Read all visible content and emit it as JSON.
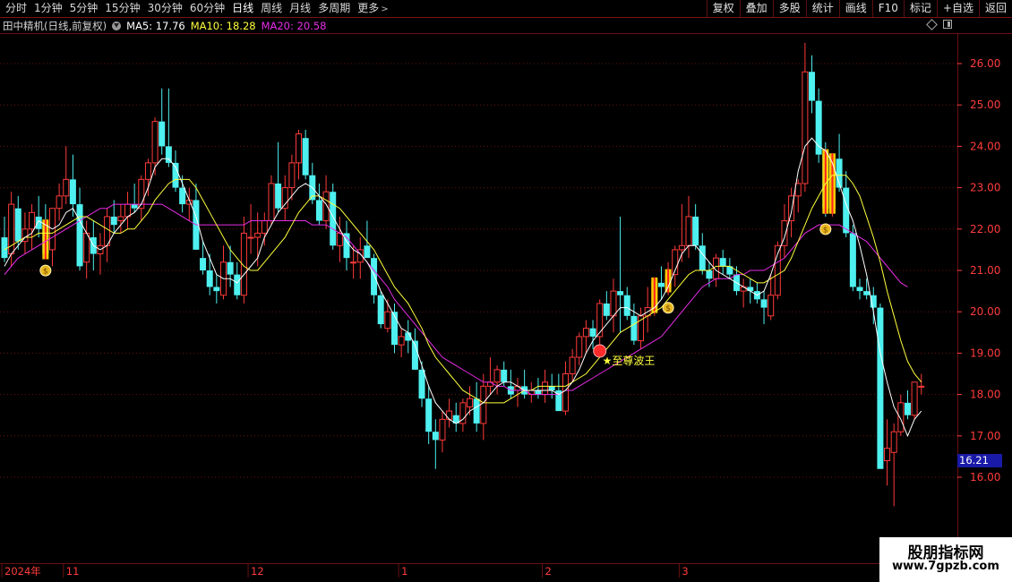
{
  "toolbar": {
    "tabs": [
      {
        "label": "分时",
        "active": false
      },
      {
        "label": "1分钟",
        "active": false
      },
      {
        "label": "5分钟",
        "active": false
      },
      {
        "label": "15分钟",
        "active": false
      },
      {
        "label": "30分钟",
        "active": false
      },
      {
        "label": "60分钟",
        "active": false
      },
      {
        "label": "日线",
        "active": true
      },
      {
        "label": "周线",
        "active": false
      },
      {
        "label": "月线",
        "active": false
      },
      {
        "label": "多周期",
        "active": false
      },
      {
        "label": "更多",
        "active": false
      }
    ],
    "tools": [
      "复权",
      "叠加",
      "多股",
      "统计",
      "画线",
      "F10",
      "标记",
      "+自选",
      "返回"
    ]
  },
  "info": {
    "stock_name": "田中精机(日线,前复权)",
    "ma5": "MA5: 17.76",
    "ma10": "MA10: 18.28",
    "ma20": "MA20: 20.58"
  },
  "colors": {
    "up": "#ff3a3a",
    "down": "#4ef0f0",
    "ma5": "#ffffff",
    "ma10": "#ffff3c",
    "ma20": "#e62de6",
    "grid": "#6a1010",
    "axis_text": "#ff3c3c",
    "signal": "#ffd700"
  },
  "price_axis": {
    "labels": [
      "26.00",
      "25.00",
      "24.00",
      "23.00",
      "22.00",
      "21.00",
      "20.00",
      "19.00",
      "18.00",
      "17.00",
      "16.00"
    ],
    "current": "16.21"
  },
  "date_axis": {
    "labels": [
      "2024年",
      "11",
      "12",
      "1",
      "2",
      "3"
    ]
  },
  "annotations": {
    "signal_text": "★至尊波王"
  },
  "watermark": {
    "line1": "股朋指标网",
    "line2": "www.7gpzb.com"
  },
  "chart_data": {
    "type": "candlestick",
    "ylim": [
      15.2,
      26.9
    ],
    "ohlc": [
      [
        21.8,
        22.3,
        21.2,
        21.3
      ],
      [
        21.4,
        22.9,
        21.1,
        22.6
      ],
      [
        22.5,
        22.8,
        21.5,
        21.7
      ],
      [
        21.7,
        22.4,
        21.4,
        22.0
      ],
      [
        22.0,
        22.6,
        21.5,
        22.4
      ],
      [
        22.3,
        22.8,
        21.8,
        22.0
      ],
      [
        22.1,
        22.6,
        21.3,
        21.4
      ],
      [
        21.5,
        22.5,
        21.1,
        22.5
      ],
      [
        22.5,
        23.1,
        22.2,
        22.8
      ],
      [
        22.8,
        24.0,
        22.6,
        23.2
      ],
      [
        23.2,
        23.8,
        22.3,
        22.6
      ],
      [
        22.6,
        23.0,
        21.0,
        21.1
      ],
      [
        21.2,
        22.2,
        20.8,
        21.9
      ],
      [
        21.8,
        22.2,
        21.0,
        21.4
      ],
      [
        21.4,
        21.9,
        20.9,
        21.6
      ],
      [
        21.6,
        22.5,
        21.2,
        22.3
      ],
      [
        22.3,
        22.7,
        21.9,
        22.1
      ],
      [
        22.2,
        22.6,
        21.9,
        22.3
      ],
      [
        22.3,
        22.9,
        22.0,
        22.6
      ],
      [
        22.6,
        23.1,
        22.4,
        22.5
      ],
      [
        22.5,
        23.3,
        22.2,
        23.2
      ],
      [
        23.2,
        23.7,
        22.8,
        23.6
      ],
      [
        23.6,
        24.7,
        23.3,
        24.6
      ],
      [
        24.6,
        25.4,
        23.8,
        24.0
      ],
      [
        24.0,
        25.4,
        23.5,
        23.6
      ],
      [
        23.6,
        23.9,
        22.9,
        23.0
      ],
      [
        23.0,
        23.3,
        22.4,
        22.6
      ],
      [
        22.6,
        23.0,
        22.2,
        22.7
      ],
      [
        22.7,
        23.1,
        21.9,
        21.5
      ],
      [
        21.3,
        21.7,
        20.9,
        21.0
      ],
      [
        21.0,
        21.4,
        20.4,
        20.6
      ],
      [
        20.6,
        20.9,
        20.2,
        20.5
      ],
      [
        20.4,
        21.6,
        20.3,
        21.2
      ],
      [
        21.2,
        21.6,
        20.6,
        20.9
      ],
      [
        20.9,
        21.2,
        20.3,
        20.4
      ],
      [
        20.4,
        22.3,
        20.2,
        21.9
      ],
      [
        21.8,
        22.6,
        21.4,
        21.8
      ],
      [
        21.8,
        22.4,
        21.1,
        21.9
      ],
      [
        21.9,
        22.4,
        21.6,
        22.2
      ],
      [
        22.2,
        23.3,
        22.1,
        23.1
      ],
      [
        23.1,
        24.1,
        22.4,
        22.5
      ],
      [
        22.5,
        23.3,
        22.2,
        23.0
      ],
      [
        23.0,
        23.8,
        22.7,
        23.6
      ],
      [
        23.6,
        24.4,
        23.2,
        24.3
      ],
      [
        24.2,
        24.4,
        23.2,
        23.3
      ],
      [
        23.3,
        23.6,
        22.6,
        22.7
      ],
      [
        22.7,
        23.1,
        22.1,
        22.2
      ],
      [
        22.2,
        23.3,
        22.0,
        22.9
      ],
      [
        22.9,
        23.1,
        21.5,
        21.6
      ],
      [
        21.6,
        22.3,
        21.2,
        21.9
      ],
      [
        21.9,
        22.2,
        21.0,
        21.3
      ],
      [
        21.2,
        21.6,
        20.8,
        21.2
      ],
      [
        21.2,
        21.8,
        20.8,
        21.5
      ],
      [
        21.6,
        22.2,
        21.5,
        21.3
      ],
      [
        21.3,
        21.4,
        20.2,
        20.4
      ],
      [
        20.4,
        20.5,
        19.6,
        19.7
      ],
      [
        19.6,
        20.3,
        19.5,
        20.0
      ],
      [
        20.0,
        20.2,
        19.0,
        19.2
      ],
      [
        19.2,
        19.6,
        18.9,
        19.4
      ],
      [
        19.5,
        19.8,
        19.0,
        19.3
      ],
      [
        19.3,
        19.6,
        18.6,
        18.6
      ],
      [
        18.6,
        18.8,
        17.7,
        17.9
      ],
      [
        17.9,
        18.2,
        16.8,
        17.1
      ],
      [
        17.1,
        17.4,
        16.2,
        16.9
      ],
      [
        16.9,
        17.6,
        16.6,
        17.4
      ],
      [
        17.4,
        17.9,
        17.2,
        17.6
      ],
      [
        17.5,
        17.8,
        17.1,
        17.3
      ],
      [
        17.3,
        17.9,
        17.1,
        17.8
      ],
      [
        17.7,
        18.2,
        17.5,
        17.9
      ],
      [
        17.9,
        18.3,
        17.1,
        17.3
      ],
      [
        17.3,
        18.5,
        16.9,
        18.2
      ],
      [
        18.2,
        18.9,
        18.0,
        18.3
      ],
      [
        18.3,
        18.7,
        18.0,
        18.6
      ],
      [
        18.6,
        18.8,
        18.2,
        18.3
      ],
      [
        18.2,
        18.6,
        17.9,
        18.0
      ],
      [
        18.1,
        18.4,
        17.7,
        18.2
      ],
      [
        18.2,
        18.6,
        17.9,
        18.0
      ],
      [
        18.0,
        18.3,
        17.8,
        18.1
      ],
      [
        18.1,
        18.4,
        17.9,
        18.0
      ],
      [
        18.0,
        18.6,
        17.8,
        18.3
      ],
      [
        18.2,
        18.5,
        17.9,
        18.1
      ],
      [
        18.1,
        18.5,
        17.6,
        17.6
      ],
      [
        17.6,
        18.8,
        17.5,
        18.5
      ],
      [
        18.5,
        19.1,
        18.3,
        18.9
      ],
      [
        18.9,
        19.5,
        18.7,
        19.4
      ],
      [
        19.4,
        19.8,
        19.0,
        19.6
      ],
      [
        19.6,
        19.8,
        19.1,
        19.4
      ],
      [
        19.4,
        20.3,
        19.2,
        20.2
      ],
      [
        20.2,
        20.5,
        19.8,
        19.9
      ],
      [
        19.9,
        20.8,
        19.5,
        20.5
      ],
      [
        20.5,
        22.3,
        19.5,
        20.4
      ],
      [
        20.4,
        20.6,
        19.8,
        19.9
      ],
      [
        19.9,
        20.2,
        19.2,
        19.3
      ],
      [
        19.3,
        20.1,
        19.1,
        19.9
      ],
      [
        19.9,
        20.6,
        19.5,
        20.1
      ],
      [
        20.1,
        20.8,
        19.9,
        20.7
      ],
      [
        20.7,
        21.1,
        20.3,
        20.6
      ],
      [
        20.6,
        21.2,
        20.4,
        20.9
      ],
      [
        20.9,
        21.6,
        20.6,
        21.5
      ],
      [
        21.5,
        22.6,
        21.2,
        21.6
      ],
      [
        21.6,
        22.8,
        21.3,
        22.3
      ],
      [
        22.3,
        22.6,
        21.5,
        21.6
      ],
      [
        21.6,
        21.9,
        20.9,
        21.0
      ],
      [
        21.0,
        21.2,
        20.6,
        20.8
      ],
      [
        20.8,
        21.4,
        20.6,
        21.3
      ],
      [
        21.3,
        21.5,
        20.9,
        21.1
      ],
      [
        21.1,
        21.3,
        20.8,
        20.9
      ],
      [
        20.9,
        21.1,
        20.4,
        20.5
      ],
      [
        20.5,
        20.8,
        20.1,
        20.6
      ],
      [
        20.6,
        20.8,
        20.2,
        20.5
      ],
      [
        20.5,
        20.7,
        20.2,
        20.3
      ],
      [
        20.3,
        20.5,
        19.7,
        20.1
      ],
      [
        19.9,
        20.9,
        19.8,
        20.4
      ],
      [
        20.4,
        21.7,
        20.3,
        21.6
      ],
      [
        21.6,
        22.6,
        21.3,
        22.2
      ],
      [
        22.2,
        23.0,
        21.8,
        22.8
      ],
      [
        22.8,
        23.2,
        22.4,
        23.1
      ],
      [
        23.1,
        26.5,
        22.9,
        25.8
      ],
      [
        25.8,
        26.2,
        24.8,
        25.1
      ],
      [
        25.1,
        25.4,
        23.6,
        23.8
      ],
      [
        23.8,
        24.1,
        22.3,
        22.5
      ],
      [
        22.5,
        23.8,
        22.3,
        23.7
      ],
      [
        23.7,
        24.3,
        22.9,
        23.0
      ],
      [
        23.0,
        23.4,
        21.8,
        21.9
      ],
      [
        21.9,
        22.1,
        20.5,
        20.6
      ],
      [
        20.6,
        20.8,
        20.3,
        20.5
      ],
      [
        20.5,
        20.8,
        20.3,
        20.4
      ],
      [
        20.4,
        20.6,
        19.7,
        20.1
      ],
      [
        20.1,
        20.2,
        17.9,
        16.2
      ],
      [
        16.4,
        17.4,
        15.8,
        16.7
      ],
      [
        16.6,
        17.3,
        15.3,
        17.1
      ],
      [
        17.1,
        18.0,
        17.0,
        17.8
      ],
      [
        17.8,
        18.1,
        17.4,
        17.5
      ],
      [
        17.5,
        18.3,
        17.4,
        18.3
      ],
      [
        18.2,
        18.5,
        18.0,
        18.2
      ]
    ],
    "ma5": [
      21.1,
      21.4,
      21.6,
      21.8,
      21.9,
      22.2,
      22.1,
      22.0,
      22.1,
      22.4,
      22.5,
      22.2,
      21.9,
      21.6,
      21.5,
      21.6,
      21.9,
      22.1,
      22.3,
      22.4,
      22.6,
      23.0,
      23.5,
      23.7,
      23.7,
      23.5,
      23.1,
      22.7,
      22.3,
      21.7,
      21.3,
      20.9,
      20.8,
      20.8,
      20.7,
      20.9,
      21.1,
      21.3,
      21.8,
      22.1,
      22.4,
      22.6,
      22.8,
      23.0,
      23.1,
      23.0,
      22.8,
      22.6,
      22.3,
      22.0,
      21.7,
      21.5,
      21.4,
      21.2,
      20.9,
      20.5,
      20.2,
      19.9,
      19.6,
      19.5,
      19.2,
      18.7,
      18.2,
      17.8,
      17.6,
      17.4,
      17.3,
      17.4,
      17.6,
      17.7,
      17.8,
      18.0,
      18.2,
      18.3,
      18.3,
      18.2,
      18.1,
      18.1,
      18.1,
      18.1,
      18.1,
      18.0,
      18.1,
      18.3,
      18.6,
      19.0,
      19.3,
      19.5,
      19.7,
      19.9,
      20.1,
      20.1,
      20.0,
      19.9,
      20.0,
      20.1,
      20.3,
      20.6,
      21.0,
      21.4,
      21.6,
      21.6,
      21.4,
      21.2,
      21.0,
      20.9,
      20.8,
      20.7,
      20.6,
      20.5,
      20.4,
      20.5,
      20.9,
      21.4,
      21.8,
      22.4,
      23.4,
      24.0,
      24.2,
      24.0,
      23.9,
      23.6,
      23.1,
      22.6,
      22.2,
      21.6,
      20.9,
      20.0,
      19.0,
      18.3,
      17.7,
      17.4,
      17.0,
      17.4,
      17.6
    ],
    "ma10": [
      21.5,
      21.6,
      21.7,
      21.8,
      21.8,
      21.9,
      21.9,
      21.9,
      22.0,
      22.1,
      22.2,
      22.3,
      22.3,
      22.2,
      22.1,
      22.0,
      21.9,
      21.9,
      22.0,
      22.0,
      22.2,
      22.4,
      22.7,
      22.9,
      23.1,
      23.2,
      23.2,
      23.2,
      23.0,
      22.7,
      22.4,
      22.1,
      21.8,
      21.5,
      21.3,
      21.1,
      21.0,
      21.0,
      21.2,
      21.4,
      21.6,
      21.8,
      22.1,
      22.4,
      22.6,
      22.8,
      22.8,
      22.7,
      22.6,
      22.5,
      22.3,
      22.1,
      21.9,
      21.7,
      21.5,
      21.2,
      20.9,
      20.6,
      20.4,
      20.2,
      19.9,
      19.6,
      19.2,
      18.9,
      18.7,
      18.5,
      18.3,
      18.1,
      18.0,
      17.9,
      17.8,
      17.8,
      17.8,
      17.8,
      17.9,
      18.0,
      18.1,
      18.1,
      18.2,
      18.2,
      18.2,
      18.2,
      18.2,
      18.3,
      18.4,
      18.5,
      18.7,
      18.9,
      19.1,
      19.3,
      19.5,
      19.6,
      19.7,
      19.8,
      19.9,
      20.0,
      20.1,
      20.3,
      20.5,
      20.7,
      20.9,
      21.0,
      21.0,
      21.0,
      21.1,
      21.1,
      21.1,
      21.0,
      20.9,
      20.8,
      20.7,
      20.7,
      20.8,
      20.9,
      21.0,
      21.3,
      21.7,
      22.1,
      22.5,
      22.8,
      23.1,
      23.3,
      23.3,
      23.3,
      23.1,
      22.8,
      22.3,
      21.8,
      21.2,
      20.5,
      19.9,
      19.3,
      18.8,
      18.5,
      18.3
    ],
    "ma20": [
      20.9,
      21.1,
      21.3,
      21.4,
      21.5,
      21.6,
      21.7,
      21.8,
      21.9,
      22.0,
      22.1,
      22.2,
      22.3,
      22.4,
      22.5,
      22.5,
      22.6,
      22.6,
      22.6,
      22.6,
      22.6,
      22.6,
      22.6,
      22.6,
      22.5,
      22.4,
      22.3,
      22.2,
      22.1,
      22.1,
      22.1,
      22.1,
      22.1,
      22.1,
      22.1,
      22.1,
      22.2,
      22.2,
      22.2,
      22.2,
      22.2,
      22.2,
      22.2,
      22.2,
      22.2,
      22.1,
      22.1,
      22.1,
      22.0,
      21.9,
      21.8,
      21.6,
      21.4,
      21.2,
      21.0,
      20.8,
      20.6,
      20.3,
      20.1,
      19.9,
      19.7,
      19.5,
      19.3,
      19.1,
      18.9,
      18.8,
      18.7,
      18.6,
      18.5,
      18.4,
      18.3,
      18.3,
      18.2,
      18.2,
      18.1,
      18.1,
      18.1,
      18.0,
      18.0,
      18.0,
      18.0,
      18.0,
      18.1,
      18.1,
      18.2,
      18.3,
      18.4,
      18.5,
      18.6,
      18.7,
      18.8,
      18.9,
      19.0,
      19.1,
      19.2,
      19.3,
      19.4,
      19.6,
      19.8,
      20.0,
      20.2,
      20.4,
      20.6,
      20.7,
      20.8,
      20.8,
      20.8,
      20.9,
      20.9,
      21.0,
      21.0,
      21.0,
      21.1,
      21.2,
      21.3,
      21.5,
      21.7,
      21.9,
      22.0,
      22.1,
      22.1,
      22.1,
      22.1,
      22.0,
      21.9,
      21.8,
      21.7,
      21.5,
      21.3,
      21.1,
      20.9,
      20.7,
      20.6
    ],
    "signal_bars": [
      6,
      95,
      97,
      120,
      121
    ],
    "money_bag_marks": [
      6,
      97,
      120
    ],
    "date_ticks": {
      "2024年": 0,
      "11": 9,
      "12": 36,
      "1": 58,
      "2": 79,
      "3": 99
    }
  }
}
